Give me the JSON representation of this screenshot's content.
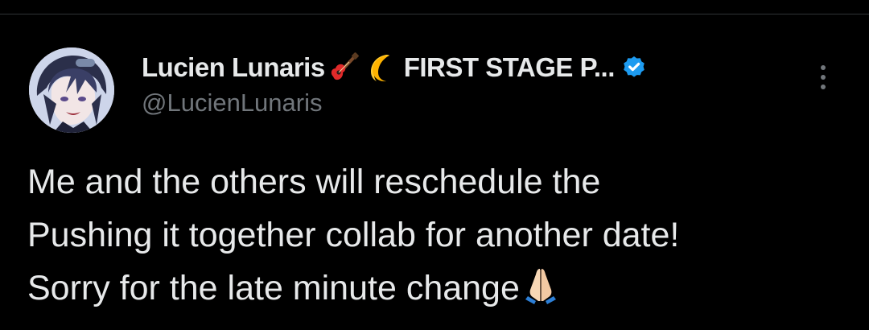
{
  "tweet": {
    "author": {
      "display_name": "Lucien Lunaris",
      "name_emojis": [
        "guitar-emoji",
        "crescent-moon-emoji"
      ],
      "name_rest": "FIRST STAGE P...",
      "handle": "@LucienLunaris",
      "verified": true,
      "verified_color": "#1d9bf0"
    },
    "text_lines": [
      "Me and the others will reschedule the",
      "Pushing it together collab for another date!",
      "Sorry for the late minute change"
    ],
    "text_trailing_emoji": "folded-hands-emoji",
    "more_icon": "more-vertical-icon"
  },
  "colors": {
    "background": "#000000",
    "primary_text": "#e7e9ea",
    "secondary_text": "#71767b",
    "divider": "#2f3336"
  }
}
